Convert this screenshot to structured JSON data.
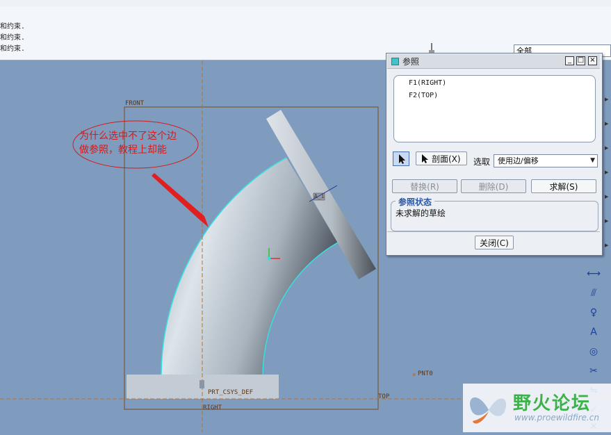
{
  "messages": [
    "和约束.",
    "和约束.",
    "和约束."
  ],
  "filter": {
    "value": "全部"
  },
  "viewport_labels": {
    "front": "FRONT",
    "top": "TOP",
    "right": "RIGHT",
    "pnt": "PNT0",
    "csys": "PRT_CSYS_DEF",
    "axis": "A_1"
  },
  "annotation": {
    "line1": "为什么选中不了这个边",
    "line2": "做参照，教程上却能"
  },
  "dialog": {
    "title": "参照",
    "references": [
      "F1(RIGHT)",
      "F2(TOP)"
    ],
    "section_button": "剖面(X)",
    "select_label": "选取",
    "select_value": "使用边/偏移",
    "replace_button": "替换(R)",
    "delete_button": "删除(D)",
    "solve_button": "求解(S)",
    "status_title": "参照状态",
    "status_text": "未求解的草绘",
    "close_button": "关闭(C)"
  },
  "watermark": {
    "title": "野火论坛",
    "url": "www.proewildfire.cn"
  },
  "colors": {
    "viewport_bg": "#7f9cbf",
    "datum": "#7a4a1e",
    "highlight": "#35e0e0",
    "annotation": "#d01c1c"
  }
}
